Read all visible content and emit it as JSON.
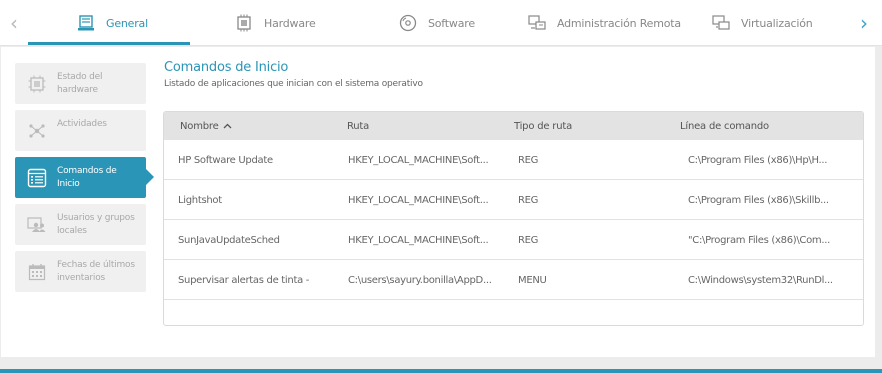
{
  "tabs": [
    {
      "label": "General",
      "icon": "server-icon",
      "active": true
    },
    {
      "label": "Hardware",
      "icon": "chip-icon",
      "active": false
    },
    {
      "label": "Software",
      "icon": "disc-icon",
      "active": false
    },
    {
      "label": "Administración Remota",
      "icon": "remote-admin-icon",
      "active": false
    },
    {
      "label": "Virtualización",
      "icon": "virtualization-icon",
      "active": false
    }
  ],
  "sidebar": {
    "items": [
      {
        "label1": "Estado del",
        "label2": "hardware",
        "icon": "chip-icon"
      },
      {
        "label1": "Actividades",
        "label2": "",
        "icon": "network-icon"
      },
      {
        "label1": "Comandos de",
        "label2": "Inicio",
        "icon": "list-icon",
        "active": true
      },
      {
        "label1": "Usuarios y grupos",
        "label2": "locales",
        "icon": "users-icon"
      },
      {
        "label1": "Fechas de últimos",
        "label2": "inventarios",
        "icon": "calendar-icon"
      }
    ]
  },
  "main": {
    "title": "Comandos de Inicio",
    "subtitle": "Listado de aplicaciones que inician con el sistema operativo"
  },
  "table": {
    "columns": [
      "Nombre",
      "Ruta",
      "Tipo de ruta",
      "Línea de comando"
    ],
    "sort_indicator": "^",
    "rows": [
      [
        "HP Software Update",
        "HKEY_LOCAL_MACHINE\\Soft...",
        "REG",
        "C:\\Program Files (x86)\\Hp\\H..."
      ],
      [
        "Lightshot",
        "HKEY_LOCAL_MACHINE\\Soft...",
        "REG",
        "C:\\Program Files (x86)\\Skillb..."
      ],
      [
        "SunJavaUpdateSched",
        "HKEY_LOCAL_MACHINE\\Soft...",
        "REG",
        "\"C:\\Program Files (x86)\\Com..."
      ],
      [
        "Supervisar alertas de tinta -",
        "C:\\users\\sayury.bonilla\\AppD...",
        "MENU",
        "C:\\Windows\\system32\\RunDl..."
      ]
    ]
  },
  "colors": {
    "accent": "#2a95b6",
    "header_bg": "#e3e3e3",
    "page_bg": "#ececec"
  }
}
